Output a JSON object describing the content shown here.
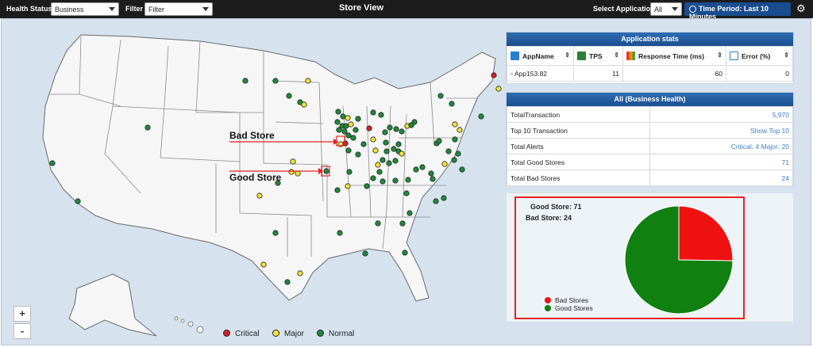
{
  "topbar": {
    "health_status_label": "Health Status",
    "health_status_value": "Business",
    "filter_label": "Filter",
    "filter_value": "Filter",
    "title": "Store View",
    "select_app_label": "Select Application",
    "select_app_value": "All",
    "time_period": "Time Period: Last 10 Minutes"
  },
  "map": {
    "zoom_in": "+",
    "zoom_out": "-",
    "legend": [
      {
        "label": "Critical",
        "color": "#d4202a"
      },
      {
        "label": "Major",
        "color": "#f2e33a"
      },
      {
        "label": "Normal",
        "color": "#1f8a3b"
      }
    ],
    "annotations": {
      "bad": "Bad Store",
      "good": "Good Store"
    }
  },
  "app_stats": {
    "title": "Application stats",
    "columns": [
      "AppName",
      "TPS",
      "Response Time (ms)",
      "Error (%)"
    ],
    "rows": [
      {
        "app": "▫ App153.82",
        "tps": "11",
        "rt": "60",
        "err": "0"
      }
    ]
  },
  "business_health": {
    "title": "All (Business Health)",
    "rows": [
      {
        "label": "TotalTransaction",
        "value": "5,970"
      },
      {
        "label": "Top 10 Transaction",
        "value": "Show Top 10"
      },
      {
        "label": "Total Alerts",
        "value": "Critical: 4 Major: 20"
      },
      {
        "label": "Total Good Stores",
        "value": "71"
      },
      {
        "label": "Total Bad Stores",
        "value": "24"
      }
    ]
  },
  "pie": {
    "good_label": "Good Store: 71",
    "bad_label": "Bad Store: 24",
    "legend": [
      {
        "label": "Bad Stores",
        "color": "#ee1111"
      },
      {
        "label": "Good Stores",
        "color": "#108010"
      }
    ],
    "values": {
      "good": 71,
      "bad": 24
    }
  },
  "colors": {
    "critical": "#d4202a",
    "major": "#f2e33a",
    "normal": "#1f8a3b",
    "header_blue": "#1b4f8f"
  }
}
